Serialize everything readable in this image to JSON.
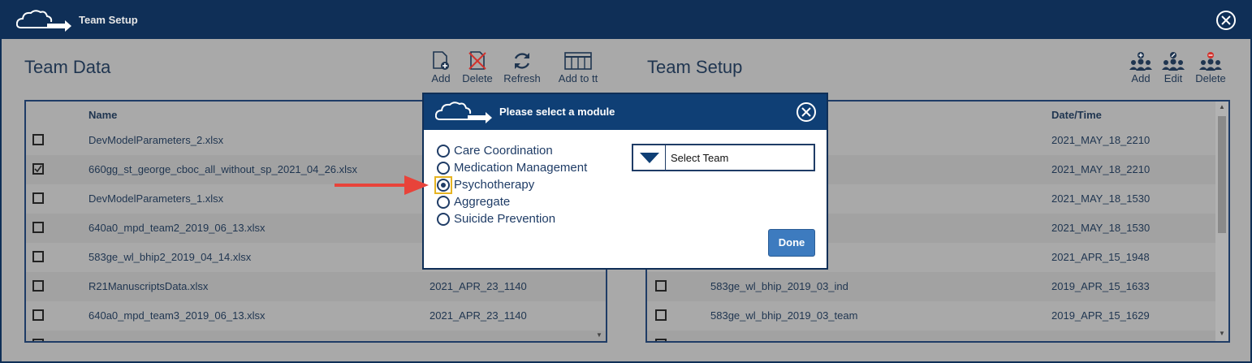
{
  "window": {
    "title": "Team Setup"
  },
  "team_data": {
    "title": "Team Data",
    "tools": [
      {
        "label": "Add",
        "icon": "add-file-icon"
      },
      {
        "label": "Delete",
        "icon": "delete-file-icon"
      },
      {
        "label": "Refresh",
        "icon": "refresh-icon"
      },
      {
        "label": "Add to tt",
        "icon": "table-icon"
      }
    ],
    "columns": {
      "name": "Name"
    },
    "rows": [
      {
        "checked": false,
        "name": "DevModelParameters_2.xlsx",
        "date": ""
      },
      {
        "checked": true,
        "name": "660gg_st_george_cboc_all_without_sp_2021_04_26.xlsx",
        "date": ""
      },
      {
        "checked": false,
        "name": "DevModelParameters_1.xlsx",
        "date": ""
      },
      {
        "checked": false,
        "name": "640a0_mpd_team2_2019_06_13.xlsx",
        "date": ""
      },
      {
        "checked": false,
        "name": "583ge_wl_bhip2_2019_04_14.xlsx",
        "date": ""
      },
      {
        "checked": false,
        "name": "R21ManuscriptsData.xlsx",
        "date": "2021_APR_23_1140"
      },
      {
        "checked": false,
        "name": "640a0_mpd_team3_2019_06_13.xlsx",
        "date": "2021_APR_23_1140"
      }
    ]
  },
  "team_setup": {
    "title": "Team Setup",
    "tools": [
      {
        "label": "Add",
        "icon": "add-user-group-icon"
      },
      {
        "label": "Edit",
        "icon": "edit-user-group-icon"
      },
      {
        "label": "Delete",
        "icon": "delete-user-group-icon"
      }
    ],
    "columns": {
      "datetime": "Date/Time"
    },
    "rows": [
      {
        "name": "",
        "date": "2021_MAY_18_2210"
      },
      {
        "name": "",
        "date": "2021_MAY_18_2210"
      },
      {
        "name": "",
        "date": "2021_MAY_18_1530"
      },
      {
        "name": "",
        "date": "2021_MAY_18_1530"
      },
      {
        "name": "",
        "date": "2021_APR_15_1948"
      },
      {
        "name": "583ge_wl_bhip_2019_03_ind",
        "date": "2019_APR_15_1633"
      },
      {
        "name": "583ge_wl_bhip_2019_03_team",
        "date": "2019_APR_15_1629"
      }
    ]
  },
  "modal": {
    "title": "Please select a module",
    "options": [
      {
        "label": "Care Coordination",
        "selected": false
      },
      {
        "label": "Medication Management",
        "selected": false
      },
      {
        "label": "Psychotherapy",
        "selected": true
      },
      {
        "label": "Aggregate",
        "selected": false
      },
      {
        "label": "Suicide Prevention",
        "selected": false
      }
    ],
    "select_team": "Select Team",
    "done_label": "Done"
  },
  "colors": {
    "titlebar": "#0f2f57",
    "modal_header": "#0f3f75",
    "done_button": "#3d7bbf",
    "arrow": "#e8433a"
  }
}
